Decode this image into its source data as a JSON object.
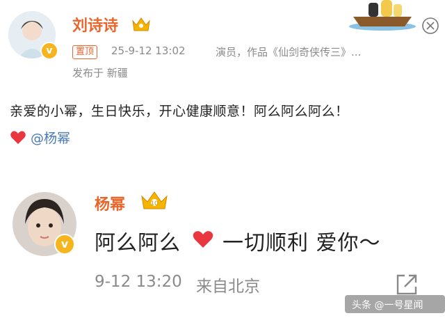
{
  "post": {
    "author": "刘诗诗",
    "pin_label": "置顶",
    "time": "25-9-12 13:02",
    "role": "演员，作品《仙剑奇侠传三》...",
    "location": "发布于 新疆",
    "text": "亲爱的小幂，生日快乐，开心健康顺意！阿么阿么阿么！",
    "mention": "@杨幂"
  },
  "reply": {
    "author": "杨幂",
    "text_a": "阿么阿么",
    "text_b": "一切顺利 爱你～",
    "time": "9-12 13:20",
    "source": "来自北京"
  },
  "watermark": "头条 @一号星闻",
  "colors": {
    "name": "#e8662c",
    "meta": "#8a8a8a",
    "mention": "#4a7bb7",
    "heart": "#e8373e",
    "badge": "#f6b51e"
  }
}
